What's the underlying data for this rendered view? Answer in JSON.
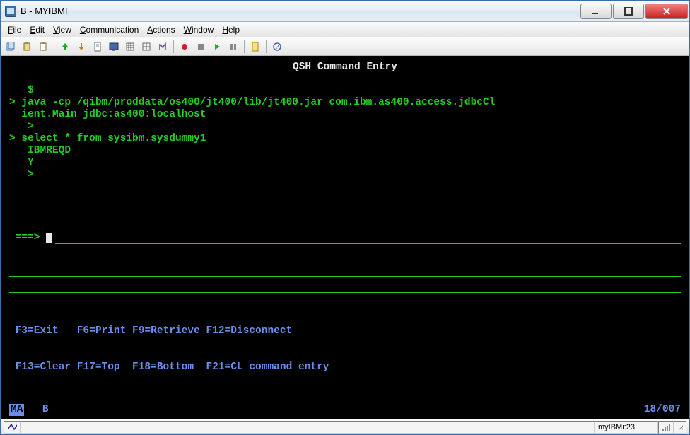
{
  "title": "B - MYIBMI",
  "menus": [
    "File",
    "Edit",
    "View",
    "Communication",
    "Actions",
    "Window",
    "Help"
  ],
  "menu_accel": [
    0,
    0,
    0,
    0,
    0,
    0,
    0
  ],
  "toolbar_icons": [
    "copy-icon",
    "paste-icon",
    "clipboard-icon",
    "up-arrow-icon",
    "down-arrow-icon",
    "document-icon",
    "screen-icon",
    "grid-icon",
    "grid2-icon",
    "scissors-icon",
    "record-icon",
    "play-icon",
    "pg-icon",
    "pg2-icon",
    "note-icon",
    "help-icon"
  ],
  "screen": {
    "title": "QSH Command Entry",
    "output": [
      "   $",
      "> java -cp /qibm/proddata/os400/jt400/lib/jt400.jar com.ibm.as400.access.jdbcCl",
      "  ient.Main jdbc:as400:localhost",
      "   >",
      "> select * from sysibm.sysdummy1",
      "   IBMREQD",
      "   Y",
      "   >"
    ],
    "prompt": " ===> ",
    "fkeys1": " F3=Exit   F6=Print F9=Retrieve F12=Disconnect",
    "fkeys2": " F13=Clear F17=Top  F18=Bottom  F21=CL command entry",
    "status_ma": "MA",
    "status_b": "B",
    "cursor_pos": "18/007"
  },
  "sysbar": {
    "connection": "myIBMi:23"
  }
}
